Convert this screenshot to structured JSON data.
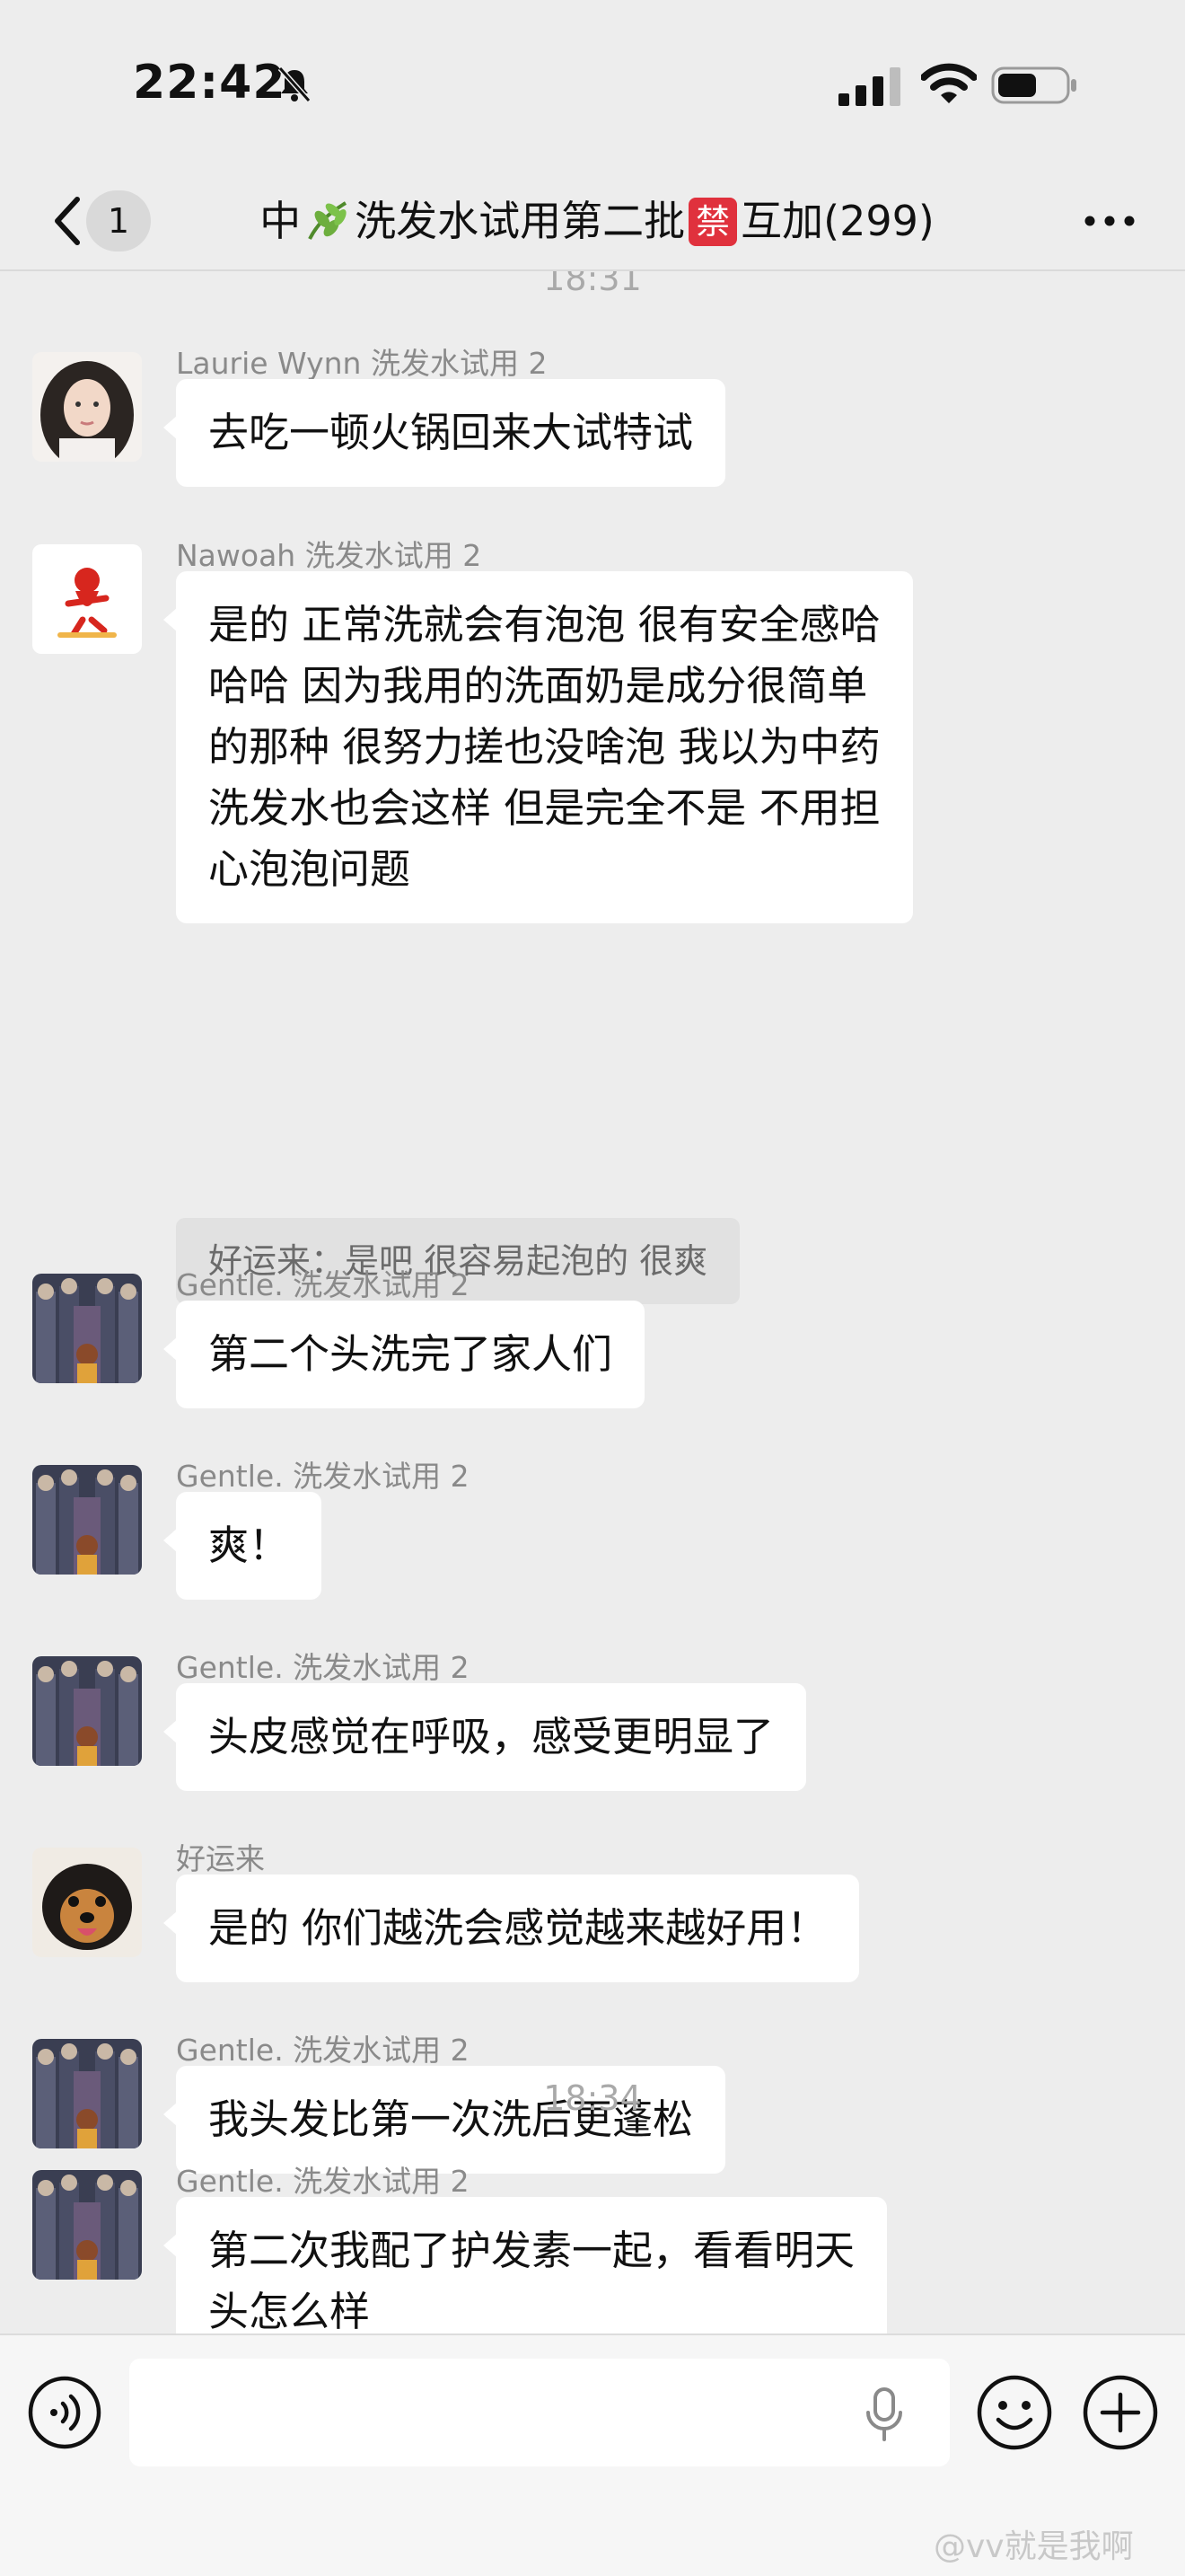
{
  "status_bar": {
    "time": "22:42"
  },
  "nav": {
    "unread_count": "1",
    "title_part1": "中",
    "title_part2": "洗发水试用第二批",
    "title_ban_char": "禁",
    "title_part3": "互加(299)"
  },
  "chat": {
    "timestamp_top": "18:31",
    "timestamp_mid": "18:34",
    "messages": [
      {
        "sender": "Laurie Wynn 洗发水试用 2",
        "text": [
          "去吃一顿火锅回来大试特试"
        ]
      },
      {
        "sender": "Nawoah 洗发水试用 2",
        "text": [
          "是的 正常洗就会有泡泡 很有安全感哈",
          "哈哈 因为我用的洗面奶是成分很简单",
          "的那种 很努力搓也没啥泡 我以为中药",
          "洗发水也会这样 但是完全不是 不用担",
          "心泡泡问题"
        ],
        "quote": "好运来：是吧 很容易起泡的 很爽"
      },
      {
        "sender": "Gentle. 洗发水试用 2",
        "text": [
          "第二个头洗完了家人们"
        ]
      },
      {
        "sender": "Gentle. 洗发水试用 2",
        "text": [
          "爽！"
        ]
      },
      {
        "sender": "Gentle. 洗发水试用 2",
        "text": [
          "头皮感觉在呼吸，感受更明显了"
        ]
      },
      {
        "sender": "好运来",
        "text": [
          "是的 你们越洗会感觉越来越好用！"
        ]
      },
      {
        "sender": "Gentle. 洗发水试用 2",
        "text": [
          "我头发比第一次洗后更蓬松"
        ]
      },
      {
        "sender": "Gentle. 洗发水试用 2",
        "text": [
          "第二次我配了护发素一起，看看明天",
          "头怎么样"
        ]
      }
    ]
  },
  "input": {
    "value": "",
    "placeholder": ""
  },
  "watermark": "@vv就是我啊",
  "icons": {
    "back": "chevron-left-icon",
    "more": "more-dots-icon",
    "voice": "voice-icon",
    "mic": "mic-icon",
    "emoji": "emoji-icon",
    "plus": "plus-icon",
    "leaf": "leaf-emoji-icon"
  },
  "colors": {
    "background": "#ededed",
    "bubble": "#ffffff",
    "quote_bg": "#e1e1e1",
    "ban_badge": "#e0313d",
    "meta_text": "#8a8a8a"
  }
}
